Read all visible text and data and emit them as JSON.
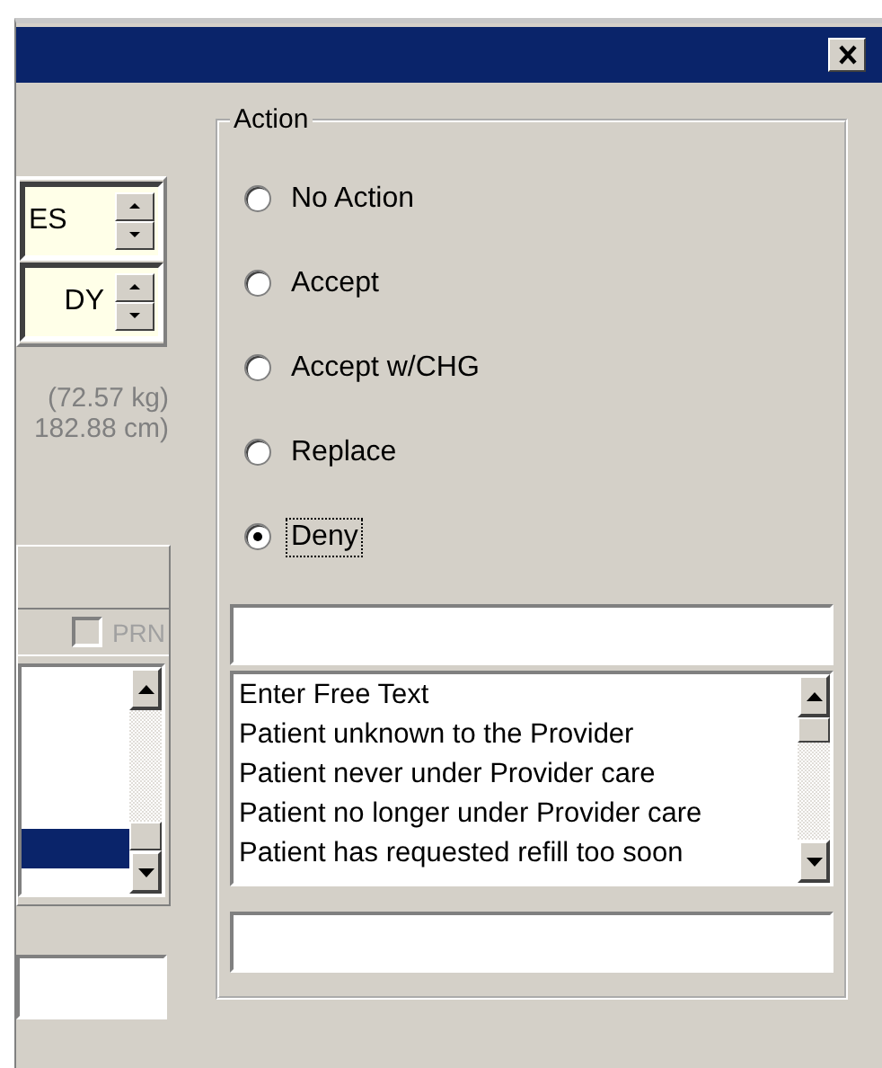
{
  "spinners": [
    {
      "value": "ES"
    },
    {
      "value": "DY"
    }
  ],
  "conversions": [
    "(72.57 kg)",
    "182.88 cm)"
  ],
  "prn": {
    "label": "PRN",
    "checked": false,
    "disabled": true
  },
  "left_list": {
    "highlighted_row": {
      "selected": true
    }
  },
  "action": {
    "title": "Action",
    "options": [
      {
        "label": "No Action",
        "selected": false
      },
      {
        "label": "Accept",
        "selected": false
      },
      {
        "label": "Accept w/CHG",
        "selected": false
      },
      {
        "label": "Replace",
        "selected": false
      },
      {
        "label": "Deny",
        "selected": true
      }
    ],
    "reasons": [
      "Enter Free Text",
      "Patient unknown to the Provider",
      "Patient never under Provider care",
      "Patient no longer under Provider care",
      "Patient has requested refill too soon"
    ]
  }
}
